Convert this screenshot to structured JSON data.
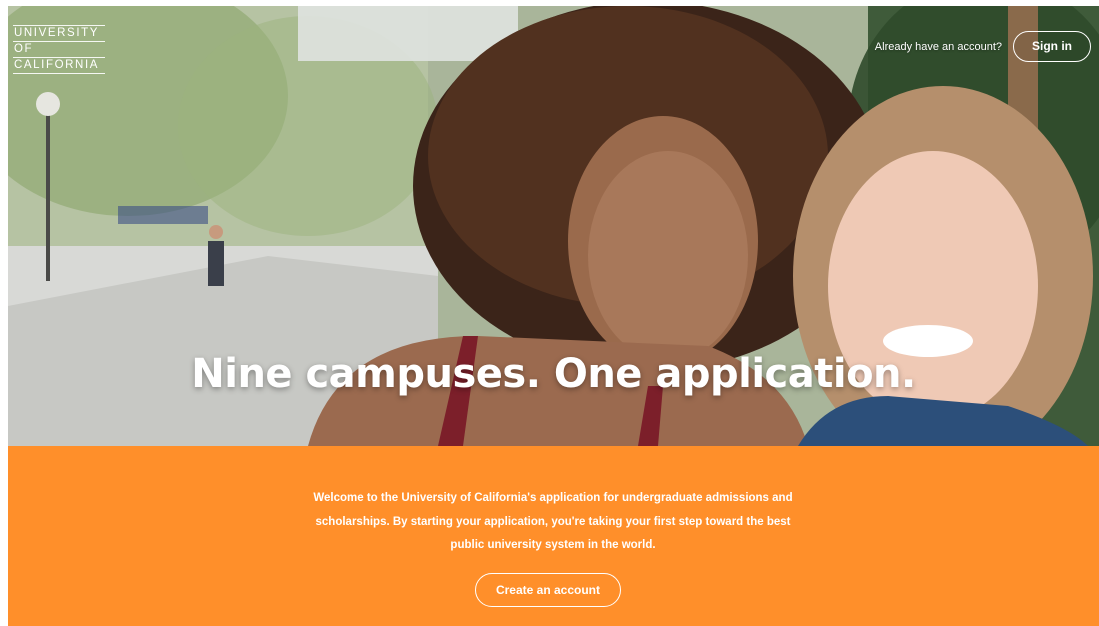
{
  "logo": {
    "line1": "UNIVERSITY",
    "line2": "OF",
    "line3": "CALIFORNIA"
  },
  "header": {
    "already_text": "Already have an account?",
    "signin_label": "Sign in"
  },
  "hero": {
    "headline": "Nine campuses. One application."
  },
  "band": {
    "welcome_text": "Welcome to the University of California's application for undergraduate admissions and scholarships. By starting your application, you're taking your first step toward the best public university system in the world.",
    "create_label": "Create an account"
  },
  "colors": {
    "accent_orange": "#ff8f2a",
    "text_white": "#ffffff"
  }
}
